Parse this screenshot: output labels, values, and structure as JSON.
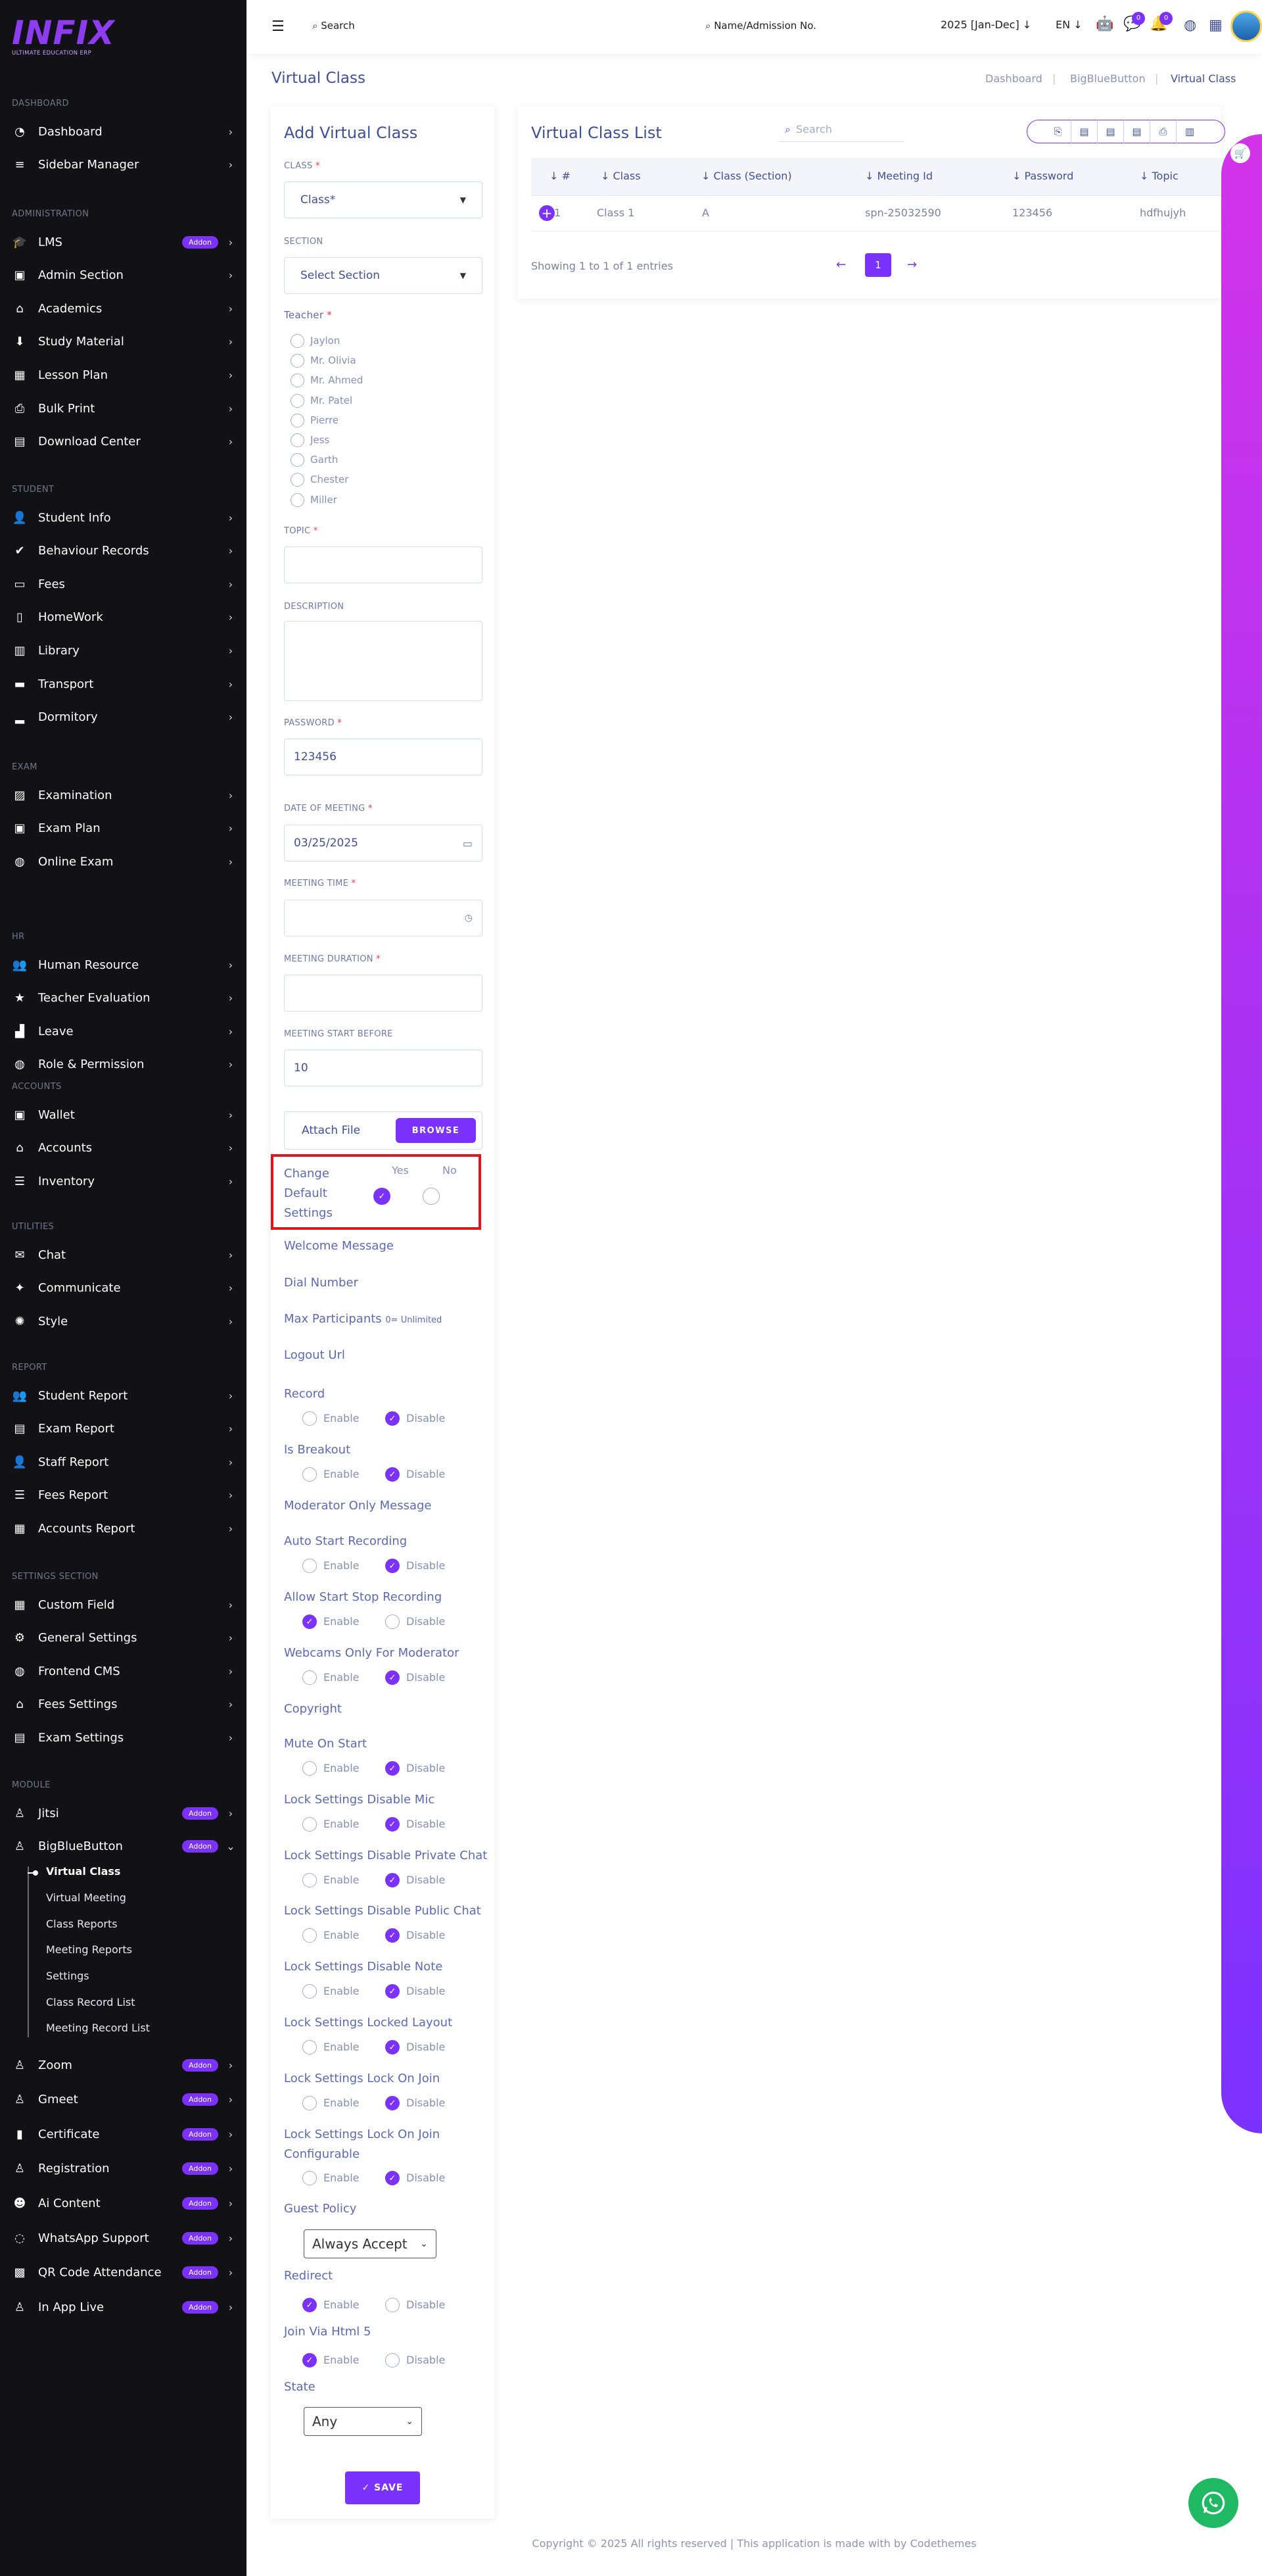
{
  "brand": {
    "logo": "INFIX",
    "tagline": "ULTIMATE EDUCATION ERP",
    "accent": "#7c32ff"
  },
  "sidebar": {
    "sections": [
      {
        "title": "DASHBOARD",
        "items": [
          {
            "label": "Dashboard",
            "icon": "speedometer-icon"
          },
          {
            "label": "Sidebar Manager",
            "icon": "bars-icon"
          }
        ]
      },
      {
        "title": "ADMINISTRATION",
        "items": [
          {
            "label": "LMS",
            "icon": "graduation-cap-icon",
            "badge": "Addon"
          },
          {
            "label": "Admin Section",
            "icon": "id-card-icon"
          },
          {
            "label": "Academics",
            "icon": "school-icon"
          },
          {
            "label": "Study Material",
            "icon": "download-icon"
          },
          {
            "label": "Lesson Plan",
            "icon": "calendar-icon"
          },
          {
            "label": "Bulk Print",
            "icon": "printer-icon"
          },
          {
            "label": "Download Center",
            "icon": "folder-icon"
          }
        ]
      },
      {
        "title": "STUDENT",
        "items": [
          {
            "label": "Student Info",
            "icon": "user-icon"
          },
          {
            "label": "Behaviour Records",
            "icon": "user-check-icon"
          },
          {
            "label": "Fees",
            "icon": "money-icon"
          },
          {
            "label": "HomeWork",
            "icon": "book-open-icon"
          },
          {
            "label": "Library",
            "icon": "library-icon"
          },
          {
            "label": "Transport",
            "icon": "bus-icon"
          },
          {
            "label": "Dormitory",
            "icon": "bed-icon"
          }
        ]
      },
      {
        "title": "EXAM",
        "items": [
          {
            "label": "Examination",
            "icon": "map-icon"
          },
          {
            "label": "Exam Plan",
            "icon": "clipboard-icon"
          },
          {
            "label": "Online Exam",
            "icon": "globe-icon"
          }
        ]
      },
      {
        "title": "HR",
        "items": [
          {
            "label": "Human Resource",
            "icon": "users-icon"
          },
          {
            "label": "Teacher Evaluation",
            "icon": "star-icon"
          },
          {
            "label": "Leave",
            "icon": "chart-icon"
          },
          {
            "label": "Role & Permission",
            "icon": "globe-icon"
          }
        ]
      },
      {
        "title": "ACCOUNTS",
        "items": [
          {
            "label": "Wallet",
            "icon": "wallet-icon"
          },
          {
            "label": "Accounts",
            "icon": "bank-icon"
          },
          {
            "label": "Inventory",
            "icon": "list-icon"
          }
        ]
      },
      {
        "title": "UTILITIES",
        "items": [
          {
            "label": "Chat",
            "icon": "chat-icon"
          },
          {
            "label": "Communicate",
            "icon": "megaphone-icon"
          },
          {
            "label": "Style",
            "icon": "palette-icon"
          }
        ]
      },
      {
        "title": "REPORT",
        "items": [
          {
            "label": "Student Report",
            "icon": "users-icon"
          },
          {
            "label": "Exam Report",
            "icon": "file-icon"
          },
          {
            "label": "Staff Report",
            "icon": "user-icon"
          },
          {
            "label": "Fees Report",
            "icon": "list-icon"
          },
          {
            "label": "Accounts Report",
            "icon": "calculator-icon"
          }
        ]
      },
      {
        "title": "SETTINGS SECTION",
        "items": [
          {
            "label": "Custom Field",
            "icon": "grid-icon"
          },
          {
            "label": "General Settings",
            "icon": "gears-icon"
          },
          {
            "label": "Frontend CMS",
            "icon": "globe-icon"
          },
          {
            "label": "Fees Settings",
            "icon": "bank-icon"
          },
          {
            "label": "Exam Settings",
            "icon": "file-icon"
          }
        ]
      },
      {
        "title": "MODULE",
        "items": [
          {
            "label": "Jitsi",
            "icon": "person-icon",
            "badge": "Addon"
          },
          {
            "label": "BigBlueButton",
            "icon": "person-icon",
            "badge": "Addon",
            "open": true
          }
        ]
      }
    ],
    "bbb_sub": [
      "Virtual Class",
      "Virtual Meeting",
      "Class Reports",
      "Meeting Reports",
      "Settings",
      "Class Record List",
      "Meeting Record List"
    ],
    "after": [
      {
        "label": "Zoom",
        "icon": "person-icon",
        "badge": "Addon"
      },
      {
        "label": "Gmeet",
        "icon": "person-icon",
        "badge": "Addon"
      },
      {
        "label": "Certificate",
        "icon": "book-icon",
        "badge": "Addon"
      },
      {
        "label": "Registration",
        "icon": "person-icon",
        "badge": "Addon"
      },
      {
        "label": "Ai Content",
        "icon": "robot-icon",
        "badge": "Addon"
      },
      {
        "label": "WhatsApp Support",
        "icon": "whatsapp-icon",
        "badge": "Addon"
      },
      {
        "label": "QR Code Attendance",
        "icon": "qr-icon",
        "badge": "Addon"
      },
      {
        "label": "In App Live",
        "icon": "person-icon",
        "badge": "Addon"
      }
    ]
  },
  "topbar": {
    "search": "Search",
    "name_search": "Name/Admission No.",
    "session": "2025 [Jan-Dec]",
    "lang": "EN",
    "msg_count": "0",
    "notif_count": "0"
  },
  "page": {
    "title": "Virtual Class",
    "breadcrumb": [
      "Dashboard",
      "BigBlueButton",
      "Virtual Class"
    ]
  },
  "form": {
    "title": "Add Virtual Class",
    "class_label": "CLASS",
    "class_value": "Class*",
    "section_label": "SECTION",
    "section_value": "Select Section",
    "teacher_label": "Teacher",
    "teachers": [
      "Jaylon",
      "Mr. Olivia",
      "Mr. Ahmed",
      "Mr. Patel",
      "Pierre",
      "Jess",
      "Garth",
      "Chester",
      "Miller"
    ],
    "topic_label": "TOPIC",
    "description_label": "DESCRIPTION",
    "password_label": "PASSWORD",
    "password_value": "123456",
    "date_label": "DATE OF MEETING",
    "date_value": "03/25/2025",
    "time_label": "MEETING TIME",
    "duration_label": "MEETING DURATION",
    "start_before_label": "MEETING START BEFORE",
    "start_before_value": "10",
    "attach_label": "Attach File",
    "browse": "BROWSE",
    "cds": {
      "label": [
        "Change",
        "Default",
        "Settings"
      ],
      "yes": "Yes",
      "no": "No"
    },
    "welcome": "Welcome Message",
    "dial": "Dial Number",
    "max": "Max Participants",
    "max_hint": "0= Unlimited",
    "logout": "Logout Url",
    "enable": "Enable",
    "disable": "Disable",
    "toggles": [
      {
        "label": [
          "Record"
        ],
        "val": "disable"
      },
      {
        "label": [
          "Is Breakout"
        ],
        "val": "disable"
      },
      {
        "label": [
          "Moderator Only Message"
        ],
        "val": null
      },
      {
        "label": [
          "Auto Start Recording"
        ],
        "val": "disable"
      },
      {
        "label": [
          "Allow Start Stop Recording"
        ],
        "val": "enable"
      },
      {
        "label": [
          "Webcams Only For Moderator"
        ],
        "val": "disable"
      },
      {
        "label": [
          "Copyright"
        ],
        "val": null
      },
      {
        "label": [
          "Mute On Start"
        ],
        "val": "disable"
      },
      {
        "label": [
          "Lock Settings Disable Mic"
        ],
        "val": "disable"
      },
      {
        "label": [
          "Lock Settings Disable Private Chat"
        ],
        "val": "disable"
      },
      {
        "label": [
          "Lock Settings Disable Public Chat"
        ],
        "val": "disable"
      },
      {
        "label": [
          "Lock Settings Disable Note"
        ],
        "val": "disable"
      },
      {
        "label": [
          "Lock Settings Locked Layout"
        ],
        "val": "disable"
      },
      {
        "label": [
          "Lock Settings Lock On Join"
        ],
        "val": "disable"
      },
      {
        "label": [
          "Lock Settings Lock On Join",
          "Configurable"
        ],
        "val": "disable"
      }
    ],
    "guest_label": "Guest Policy",
    "guest_value": "Always Accept",
    "redirect_label": "Redirect",
    "redirect_val": "enable",
    "html5_label": "Join Via Html 5",
    "html5_val": "enable",
    "state_label": "State",
    "state_value": "Any",
    "save": "✓ SAVE"
  },
  "list": {
    "title": "Virtual Class List",
    "search": "Search",
    "columns": [
      "#",
      "Class",
      "Class (Section)",
      "Meeting Id",
      "Password",
      "Topic"
    ],
    "rows": [
      [
        "1",
        "Class 1",
        "A",
        "spn-25032590",
        "123456",
        "hdfhujyh"
      ]
    ],
    "info": "Showing 1 to 1 of 1 entries",
    "page": "1"
  },
  "footer": "Copyright © 2025 All rights reserved | This application is made with by Codethemes"
}
